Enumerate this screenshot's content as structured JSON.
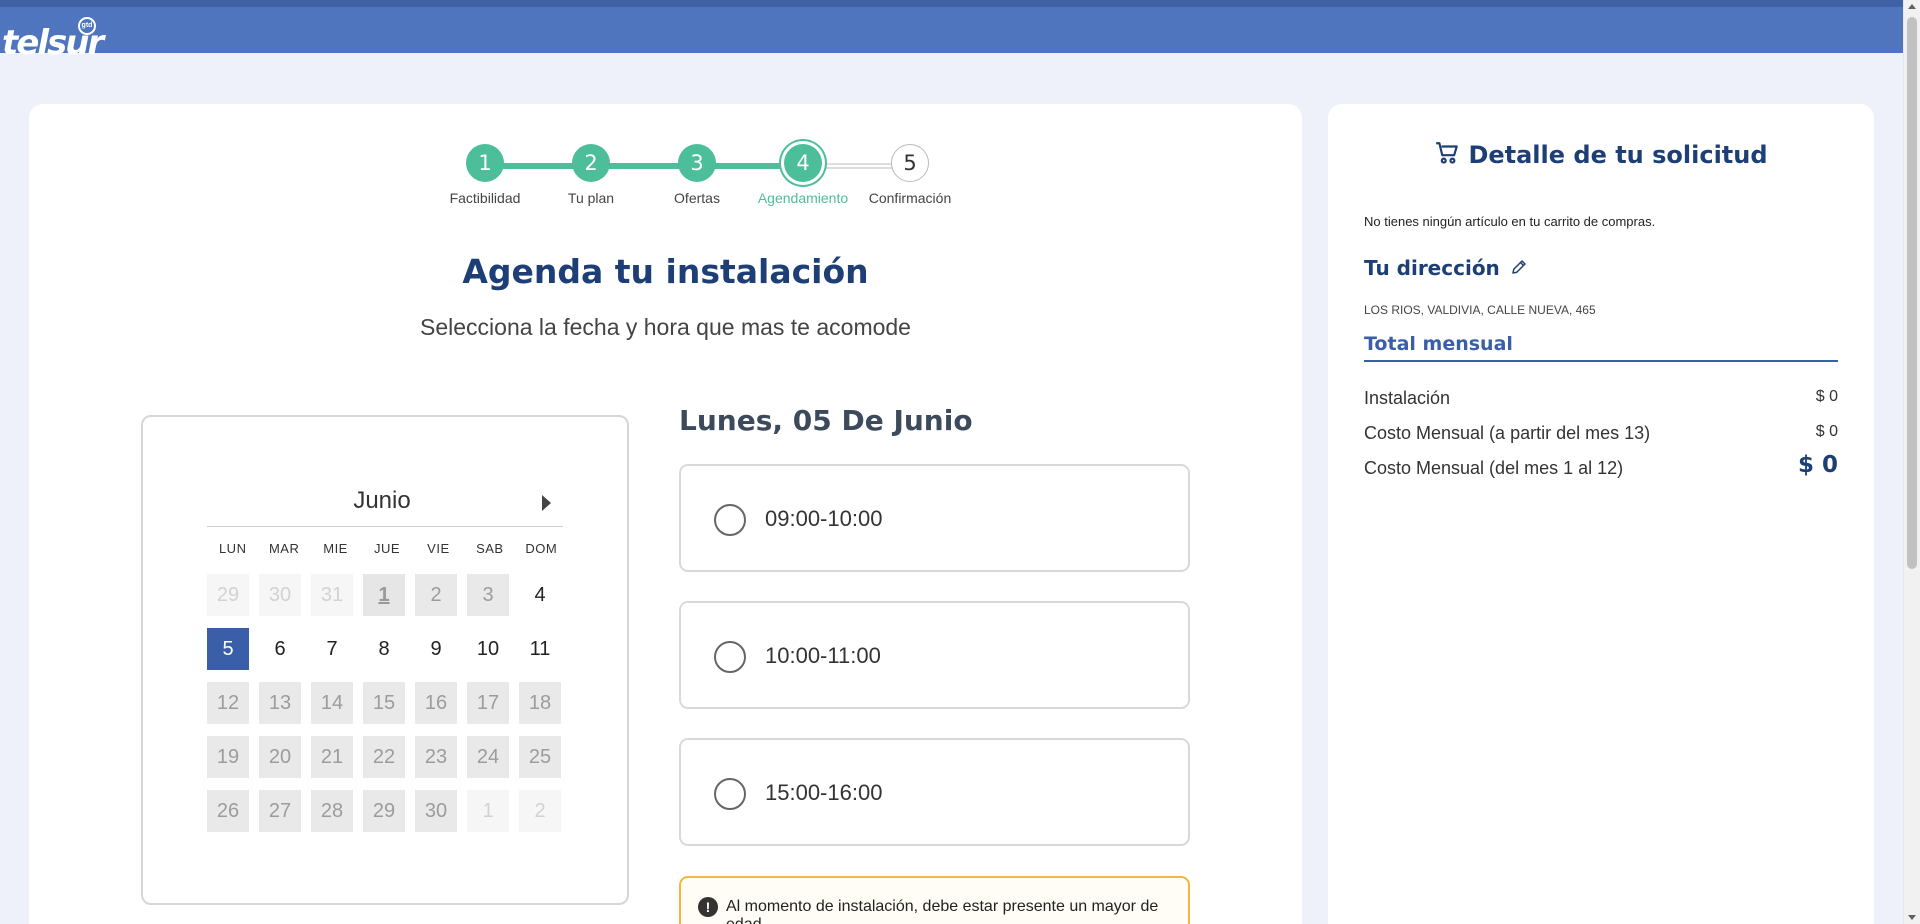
{
  "header": {
    "logo_text": "telsur",
    "logo_badge": "gtd"
  },
  "stepper": {
    "steps": [
      {
        "number": "1",
        "label": "Factibilidad",
        "state": "done"
      },
      {
        "number": "2",
        "label": "Tu plan",
        "state": "done"
      },
      {
        "number": "3",
        "label": "Ofertas",
        "state": "done"
      },
      {
        "number": "4",
        "label": "Agendamiento",
        "state": "active"
      },
      {
        "number": "5",
        "label": "Confirmación",
        "state": "pending"
      }
    ]
  },
  "main": {
    "title": "Agenda tu instalación",
    "subtitle": "Selecciona la fecha y hora que mas te acomode"
  },
  "calendar": {
    "month": "Junio",
    "weekdays": [
      "LUN",
      "MAR",
      "MIE",
      "JUE",
      "VIE",
      "SAB",
      "DOM"
    ],
    "weeks": [
      [
        {
          "d": "29",
          "s": "faded"
        },
        {
          "d": "30",
          "s": "faded"
        },
        {
          "d": "31",
          "s": "faded"
        },
        {
          "d": "1",
          "s": "today"
        },
        {
          "d": "2",
          "s": "disabled"
        },
        {
          "d": "3",
          "s": "disabled"
        },
        {
          "d": "4",
          "s": "available"
        }
      ],
      [
        {
          "d": "5",
          "s": "selected"
        },
        {
          "d": "6",
          "s": "available"
        },
        {
          "d": "7",
          "s": "available"
        },
        {
          "d": "8",
          "s": "available"
        },
        {
          "d": "9",
          "s": "available"
        },
        {
          "d": "10",
          "s": "available"
        },
        {
          "d": "11",
          "s": "available"
        }
      ],
      [
        {
          "d": "12",
          "s": "disabled"
        },
        {
          "d": "13",
          "s": "disabled"
        },
        {
          "d": "14",
          "s": "disabled"
        },
        {
          "d": "15",
          "s": "disabled"
        },
        {
          "d": "16",
          "s": "disabled"
        },
        {
          "d": "17",
          "s": "disabled"
        },
        {
          "d": "18",
          "s": "disabled"
        }
      ],
      [
        {
          "d": "19",
          "s": "disabled"
        },
        {
          "d": "20",
          "s": "disabled"
        },
        {
          "d": "21",
          "s": "disabled"
        },
        {
          "d": "22",
          "s": "disabled"
        },
        {
          "d": "23",
          "s": "disabled"
        },
        {
          "d": "24",
          "s": "disabled"
        },
        {
          "d": "25",
          "s": "disabled"
        }
      ],
      [
        {
          "d": "26",
          "s": "disabled"
        },
        {
          "d": "27",
          "s": "disabled"
        },
        {
          "d": "28",
          "s": "disabled"
        },
        {
          "d": "29",
          "s": "disabled"
        },
        {
          "d": "30",
          "s": "disabled"
        },
        {
          "d": "1",
          "s": "faded"
        },
        {
          "d": "2",
          "s": "faded"
        }
      ]
    ]
  },
  "schedule": {
    "day_title": "Lunes, 05 De Junio",
    "slots": [
      "09:00-10:00",
      "10:00-11:00",
      "15:00-16:00"
    ],
    "notice_icon": "!",
    "notice": "Al momento de instalación, debe estar presente un mayor de edad."
  },
  "side": {
    "title": "Detalle de tu solicitud",
    "empty_cart": "No tienes ningún artículo en tu carrito de compras.",
    "address_title": "Tu dirección",
    "address": "LOS RIOS, VALDIVIA, CALLE NUEVA, 465",
    "total_title": "Total mensual",
    "rows": [
      {
        "label": "Instalación",
        "value": "$ 0"
      },
      {
        "label": "Costo Mensual (a partir del mes 13)",
        "value": "$ 0"
      },
      {
        "label": "Costo Mensual (del mes 1 al 12)",
        "value": "$ 0"
      }
    ]
  },
  "colors": {
    "brand": "#4e75bd",
    "accent_green": "#4cbf9a",
    "navy": "#1e3f75",
    "selected_day": "#3a5ea8",
    "notice_border": "#f4b73c"
  },
  "icons": {
    "cart": "cart-icon",
    "edit": "pencil-icon",
    "next": "chevron-right-icon",
    "warning": "alert-icon"
  }
}
